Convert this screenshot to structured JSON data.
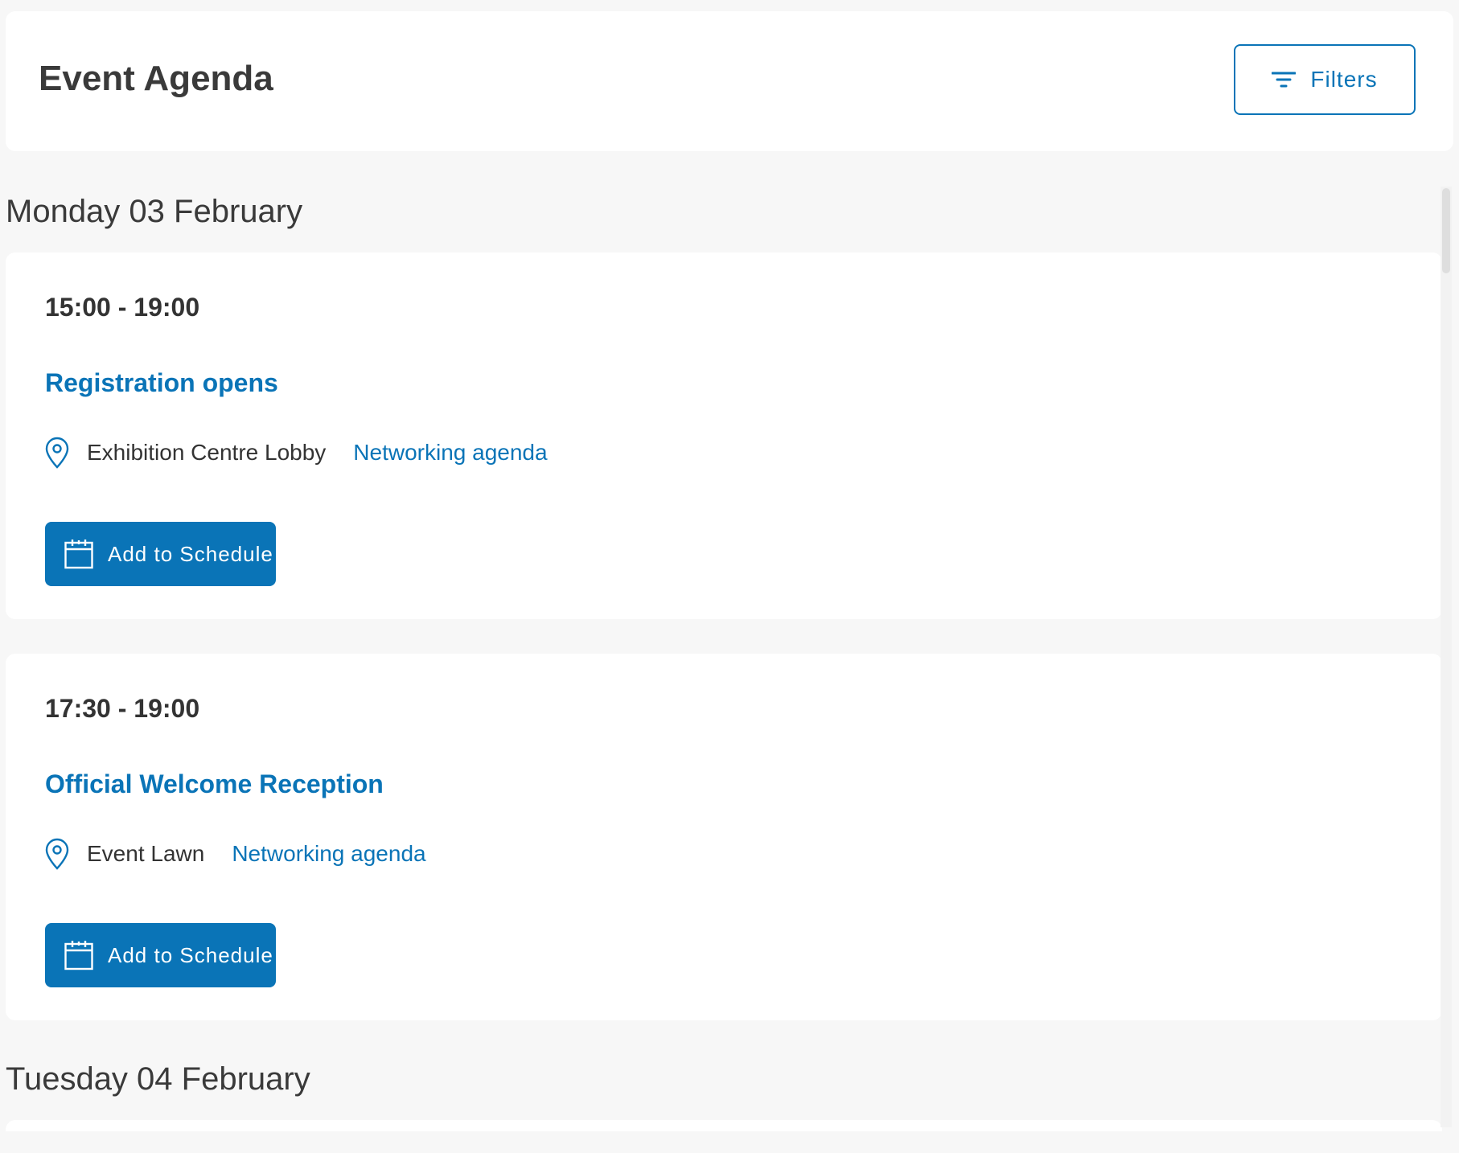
{
  "header": {
    "title": "Event Agenda",
    "filters_label": "Filters"
  },
  "days": [
    {
      "label": "Monday 03 February",
      "events": [
        {
          "time": "15:00 - 19:00",
          "title": "Registration opens",
          "location": "Exhibition Centre Lobby",
          "track": "Networking agenda",
          "button_label": "Add to Schedule"
        },
        {
          "time": "17:30 - 19:00",
          "title": "Official Welcome Reception",
          "location": "Event Lawn",
          "track": "Networking agenda",
          "button_label": "Add to Schedule"
        }
      ]
    },
    {
      "label": "Tuesday 04 February",
      "events": []
    }
  ],
  "icons": {
    "filter": "filter-icon",
    "location": "map-pin-icon",
    "calendar": "calendar-icon"
  },
  "colors": {
    "accent": "#0a74b7",
    "text": "#333333",
    "background": "#f7f7f7",
    "card": "#ffffff"
  }
}
